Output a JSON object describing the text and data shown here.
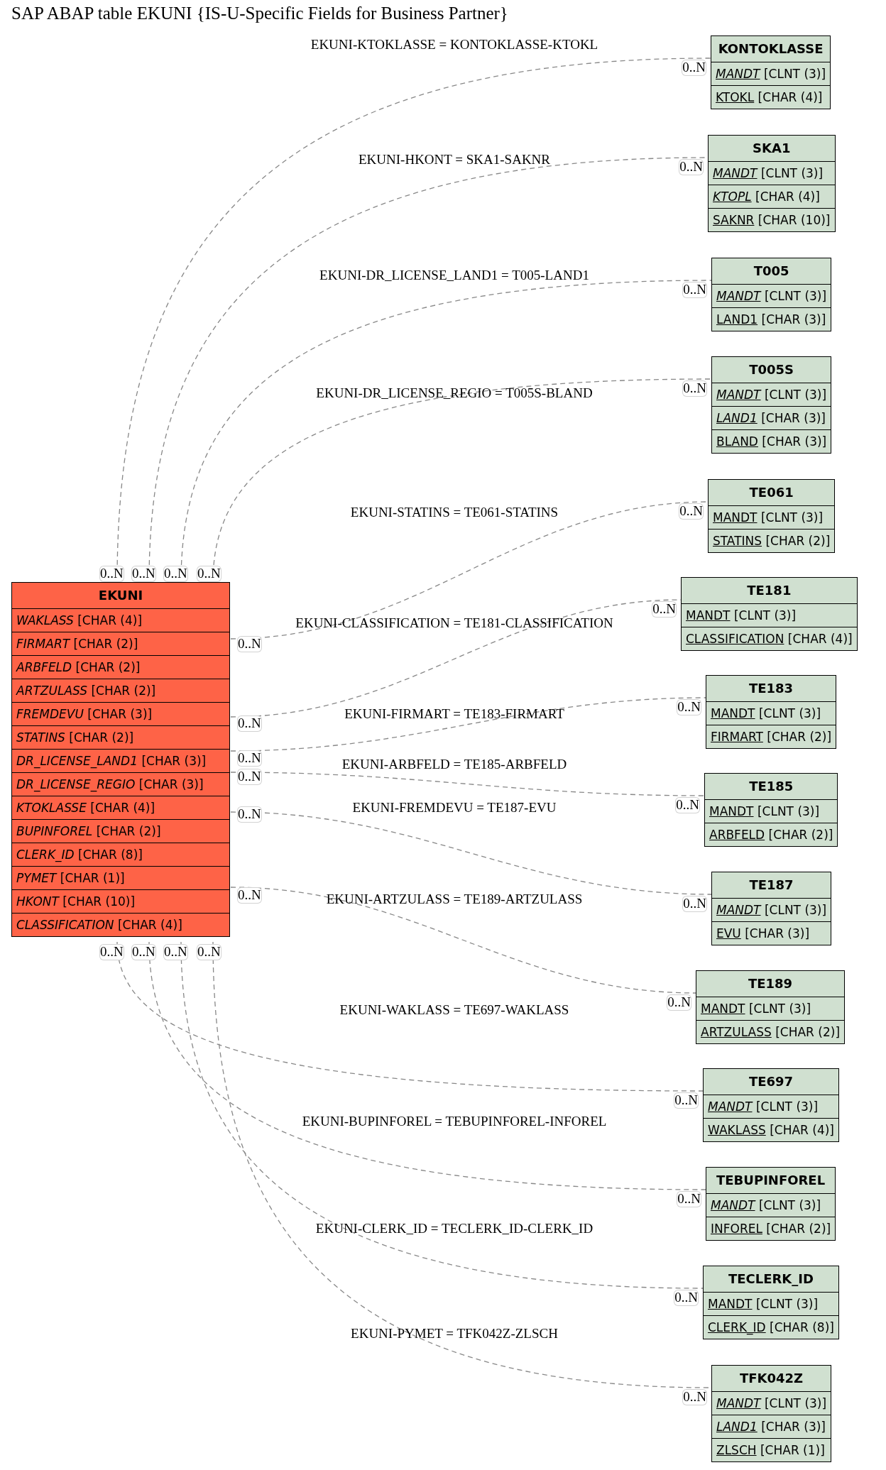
{
  "title": "SAP ABAP table EKUNI {IS-U-Specific Fields for Business Partner}",
  "main_table": {
    "name": "EKUNI",
    "fields": [
      {
        "name": "WAKLASS",
        "type": "[CHAR (4)]",
        "italic": true,
        "underline": false
      },
      {
        "name": "FIRMART",
        "type": "[CHAR (2)]",
        "italic": true,
        "underline": false
      },
      {
        "name": "ARBFELD",
        "type": "[CHAR (2)]",
        "italic": true,
        "underline": false
      },
      {
        "name": "ARTZULASS",
        "type": "[CHAR (2)]",
        "italic": true,
        "underline": false
      },
      {
        "name": "FREMDEVU",
        "type": "[CHAR (3)]",
        "italic": true,
        "underline": false
      },
      {
        "name": "STATINS",
        "type": "[CHAR (2)]",
        "italic": true,
        "underline": false
      },
      {
        "name": "DR_LICENSE_LAND1",
        "type": "[CHAR (3)]",
        "italic": true,
        "underline": false
      },
      {
        "name": "DR_LICENSE_REGIO",
        "type": "[CHAR (3)]",
        "italic": true,
        "underline": false
      },
      {
        "name": "KTOKLASSE",
        "type": "[CHAR (4)]",
        "italic": true,
        "underline": false
      },
      {
        "name": "BUPINFOREL",
        "type": "[CHAR (2)]",
        "italic": true,
        "underline": false
      },
      {
        "name": "CLERK_ID",
        "type": "[CHAR (8)]",
        "italic": true,
        "underline": false
      },
      {
        "name": "PYMET",
        "type": "[CHAR (1)]",
        "italic": true,
        "underline": false
      },
      {
        "name": "HKONT",
        "type": "[CHAR (10)]",
        "italic": true,
        "underline": false
      },
      {
        "name": "CLASSIFICATION",
        "type": "[CHAR (4)]",
        "italic": true,
        "underline": false
      }
    ]
  },
  "tables": [
    {
      "name": "KONTOKLASSE",
      "fields": [
        {
          "name": "MANDT",
          "type": "[CLNT (3)]",
          "italic": true,
          "underline": true
        },
        {
          "name": "KTOKL",
          "type": "[CHAR (4)]",
          "italic": false,
          "underline": true
        }
      ]
    },
    {
      "name": "SKA1",
      "fields": [
        {
          "name": "MANDT",
          "type": "[CLNT (3)]",
          "italic": true,
          "underline": true
        },
        {
          "name": "KTOPL",
          "type": "[CHAR (4)]",
          "italic": true,
          "underline": true
        },
        {
          "name": "SAKNR",
          "type": "[CHAR (10)]",
          "italic": false,
          "underline": true
        }
      ]
    },
    {
      "name": "T005",
      "fields": [
        {
          "name": "MANDT",
          "type": "[CLNT (3)]",
          "italic": true,
          "underline": true
        },
        {
          "name": "LAND1",
          "type": "[CHAR (3)]",
          "italic": false,
          "underline": true
        }
      ]
    },
    {
      "name": "T005S",
      "fields": [
        {
          "name": "MANDT",
          "type": "[CLNT (3)]",
          "italic": true,
          "underline": true
        },
        {
          "name": "LAND1",
          "type": "[CHAR (3)]",
          "italic": true,
          "underline": true
        },
        {
          "name": "BLAND",
          "type": "[CHAR (3)]",
          "italic": false,
          "underline": true
        }
      ]
    },
    {
      "name": "TE061",
      "fields": [
        {
          "name": "MANDT",
          "type": "[CLNT (3)]",
          "italic": false,
          "underline": true
        },
        {
          "name": "STATINS",
          "type": "[CHAR (2)]",
          "italic": false,
          "underline": true
        }
      ]
    },
    {
      "name": "TE181",
      "fields": [
        {
          "name": "MANDT",
          "type": "[CLNT (3)]",
          "italic": false,
          "underline": true
        },
        {
          "name": "CLASSIFICATION",
          "type": "[CHAR (4)]",
          "italic": false,
          "underline": true
        }
      ]
    },
    {
      "name": "TE183",
      "fields": [
        {
          "name": "MANDT",
          "type": "[CLNT (3)]",
          "italic": false,
          "underline": true
        },
        {
          "name": "FIRMART",
          "type": "[CHAR (2)]",
          "italic": false,
          "underline": true
        }
      ]
    },
    {
      "name": "TE185",
      "fields": [
        {
          "name": "MANDT",
          "type": "[CLNT (3)]",
          "italic": false,
          "underline": true
        },
        {
          "name": "ARBFELD",
          "type": "[CHAR (2)]",
          "italic": false,
          "underline": true
        }
      ]
    },
    {
      "name": "TE187",
      "fields": [
        {
          "name": "MANDT",
          "type": "[CLNT (3)]",
          "italic": true,
          "underline": true
        },
        {
          "name": "EVU",
          "type": "[CHAR (3)]",
          "italic": false,
          "underline": true
        }
      ]
    },
    {
      "name": "TE189",
      "fields": [
        {
          "name": "MANDT",
          "type": "[CLNT (3)]",
          "italic": false,
          "underline": true
        },
        {
          "name": "ARTZULASS",
          "type": "[CHAR (2)]",
          "italic": false,
          "underline": true
        }
      ]
    },
    {
      "name": "TE697",
      "fields": [
        {
          "name": "MANDT",
          "type": "[CLNT (3)]",
          "italic": true,
          "underline": true
        },
        {
          "name": "WAKLASS",
          "type": "[CHAR (4)]",
          "italic": false,
          "underline": true
        }
      ]
    },
    {
      "name": "TEBUPINFOREL",
      "fields": [
        {
          "name": "MANDT",
          "type": "[CLNT (3)]",
          "italic": true,
          "underline": true
        },
        {
          "name": "INFOREL",
          "type": "[CHAR (2)]",
          "italic": false,
          "underline": true
        }
      ]
    },
    {
      "name": "TECLERK_ID",
      "fields": [
        {
          "name": "MANDT",
          "type": "[CLNT (3)]",
          "italic": false,
          "underline": true
        },
        {
          "name": "CLERK_ID",
          "type": "[CHAR (8)]",
          "italic": false,
          "underline": true
        }
      ]
    },
    {
      "name": "TFK042Z",
      "fields": [
        {
          "name": "MANDT",
          "type": "[CLNT (3)]",
          "italic": true,
          "underline": true
        },
        {
          "name": "LAND1",
          "type": "[CHAR (3)]",
          "italic": true,
          "underline": true
        },
        {
          "name": "ZLSCH",
          "type": "[CHAR (1)]",
          "italic": false,
          "underline": true
        }
      ]
    }
  ],
  "relations": [
    {
      "label": "EKUNI-KTOKLASSE = KONTOKLASSE-KTOKL",
      "source_cardinality": "0..N",
      "target_cardinality": "0..N"
    },
    {
      "label": "EKUNI-HKONT = SKA1-SAKNR",
      "source_cardinality": "0..N",
      "target_cardinality": "0..N"
    },
    {
      "label": "EKUNI-DR_LICENSE_LAND1 = T005-LAND1",
      "source_cardinality": "0..N",
      "target_cardinality": "0..N"
    },
    {
      "label": "EKUNI-DR_LICENSE_REGIO = T005S-BLAND",
      "source_cardinality": "0..N",
      "target_cardinality": "0..N"
    },
    {
      "label": "EKUNI-STATINS = TE061-STATINS",
      "source_cardinality": "0..N",
      "target_cardinality": "0..N"
    },
    {
      "label": "EKUNI-CLASSIFICATION = TE181-CLASSIFICATION",
      "source_cardinality": "0..N",
      "target_cardinality": "0..N"
    },
    {
      "label": "EKUNI-FIRMART = TE183-FIRMART",
      "source_cardinality": "0..N",
      "target_cardinality": "0..N"
    },
    {
      "label": "EKUNI-ARBFELD = TE185-ARBFELD",
      "source_cardinality": "0..N",
      "target_cardinality": "0..N"
    },
    {
      "label": "EKUNI-FREMDEVU = TE187-EVU",
      "source_cardinality": "0..N",
      "target_cardinality": "0..N"
    },
    {
      "label": "EKUNI-ARTZULASS = TE189-ARTZULASS",
      "source_cardinality": "0..N",
      "target_cardinality": "0..N"
    },
    {
      "label": "EKUNI-WAKLASS = TE697-WAKLASS",
      "source_cardinality": "0..N",
      "target_cardinality": "0..N"
    },
    {
      "label": "EKUNI-BUPINFOREL = TEBUPINFOREL-INFOREL",
      "source_cardinality": "0..N",
      "target_cardinality": "0..N"
    },
    {
      "label": "EKUNI-CLERK_ID = TECLERK_ID-CLERK_ID",
      "source_cardinality": "0..N",
      "target_cardinality": "0..N"
    },
    {
      "label": "EKUNI-PYMET = TFK042Z-ZLSCH",
      "source_cardinality": "0..N",
      "target_cardinality": "0..N"
    }
  ]
}
